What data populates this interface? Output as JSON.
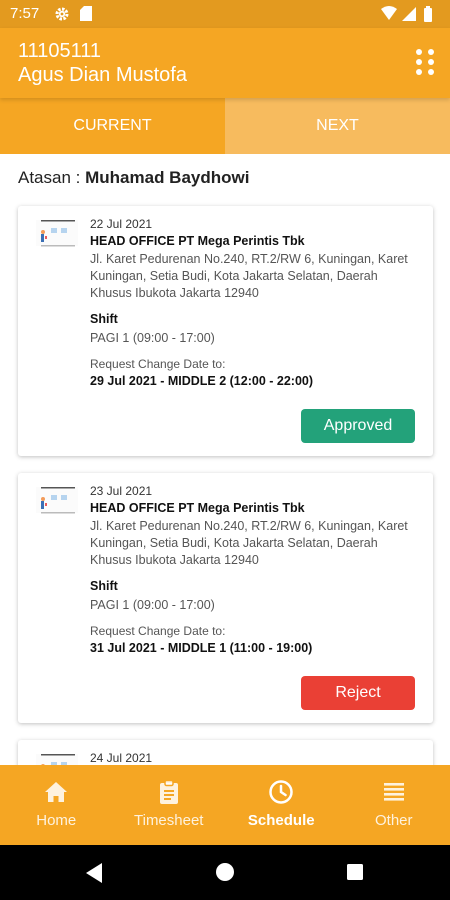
{
  "status_bar": {
    "time": "7:57",
    "icons": [
      "settings-gear-icon",
      "sd-card-icon",
      "wifi-icon",
      "signal-icon",
      "battery-icon"
    ]
  },
  "header": {
    "user_id": "11105111",
    "user_name": "Agus Dian Mustofa",
    "menu_icon": "grid-dots-menu-icon"
  },
  "tabs": [
    {
      "label": "CURRENT",
      "active": true
    },
    {
      "label": "NEXT",
      "active": false
    }
  ],
  "supervisor": {
    "label": "Atasan : ",
    "name": "Muhamad Baydhowi"
  },
  "cards": [
    {
      "date": "22 Jul 2021",
      "office": "HEAD OFFICE PT Mega Perintis Tbk",
      "address": "Jl. Karet Pedurenan No.240, RT.2/RW 6, Kuningan, Karet Kuningan, Setia Budi, Kota Jakarta Selatan, Daerah Khusus Ibukota Jakarta 12940",
      "shift_label": "Shift",
      "shift_value": "PAGI 1 (09:00 - 17:00)",
      "request_label": "Request Change Date to:",
      "request_value": "29 Jul 2021 - MIDDLE 2 (12:00 - 22:00)",
      "status": "Approved",
      "status_color": "#23a27a"
    },
    {
      "date": "23 Jul 2021",
      "office": "HEAD OFFICE PT Mega Perintis Tbk",
      "address": "Jl. Karet Pedurenan No.240, RT.2/RW 6, Kuningan, Karet Kuningan, Setia Budi, Kota Jakarta Selatan, Daerah Khusus Ibukota Jakarta 12940",
      "shift_label": "Shift",
      "shift_value": "PAGI 1 (09:00 - 17:00)",
      "request_label": "Request Change Date to:",
      "request_value": "31 Jul 2021 - MIDDLE 1 (11:00 - 19:00)",
      "status": "Reject",
      "status_color": "#ea4035"
    },
    {
      "date": "24 Jul 2021"
    }
  ],
  "bottom_nav": [
    {
      "label": "Home",
      "icon": "home-icon",
      "active": false
    },
    {
      "label": "Timesheet",
      "icon": "clipboard-icon",
      "active": false
    },
    {
      "label": "Schedule",
      "icon": "clock-icon",
      "active": true
    },
    {
      "label": "Other",
      "icon": "list-menu-icon",
      "active": false
    }
  ],
  "colors": {
    "primary": "#f5a623",
    "status_bar": "#e39a1f",
    "tab_inactive": "#f7bb5e",
    "approved": "#23a27a",
    "reject": "#ea4035"
  }
}
